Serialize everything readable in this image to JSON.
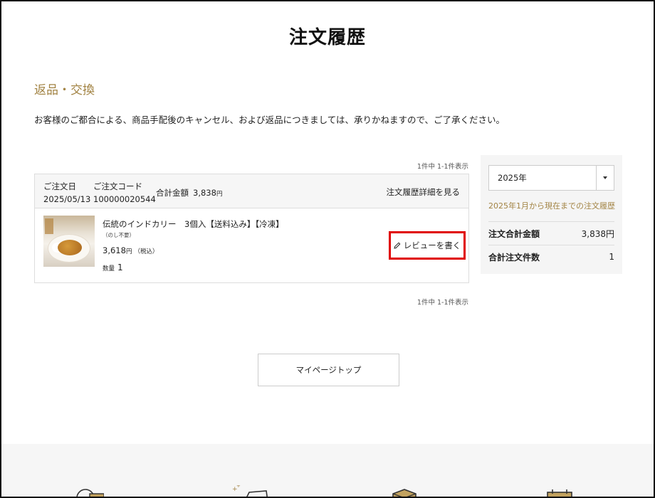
{
  "page": {
    "title": "注文履歴"
  },
  "returns": {
    "heading": "返品・交換",
    "notice": "お客様のご都合による、商品手配後のキャンセル、および返品につきましては、承りかねますので、ご了承ください。"
  },
  "pager": {
    "text": "1件中 1-1件表示"
  },
  "order": {
    "date_label": "ご注文日",
    "date_value": "2025/05/13",
    "code_label": "ご注文コード",
    "code_value": "100000020544",
    "total_label": "合計金額",
    "total_value": "3,838",
    "total_unit": "円",
    "detail_link": "注文履歴詳細を見る",
    "item": {
      "name": "伝統のインドカリー　3個入【送料込み】【冷凍】",
      "note": "（のし不要）",
      "price": "3,618",
      "price_unit": "円",
      "tax_note": "（税込）",
      "qty_label": "数量",
      "qty_value": "1"
    },
    "review_button": "レビューを書く"
  },
  "filter": {
    "selected_year": "2025年",
    "range_text": "2025年1月から現在までの注文履歴",
    "stats": [
      {
        "label": "注文合計金額",
        "value": "3,838円"
      },
      {
        "label": "合計注文件数",
        "value": "1"
      }
    ]
  },
  "nav": {
    "mypage_top": "マイページトップ"
  },
  "colors": {
    "accent": "#a28343",
    "highlight_border": "#e00000"
  },
  "icons": [
    "pencil-icon",
    "chevron-down-icon",
    "yen-icon",
    "card-icon",
    "box-icon",
    "calendar-icon"
  ]
}
